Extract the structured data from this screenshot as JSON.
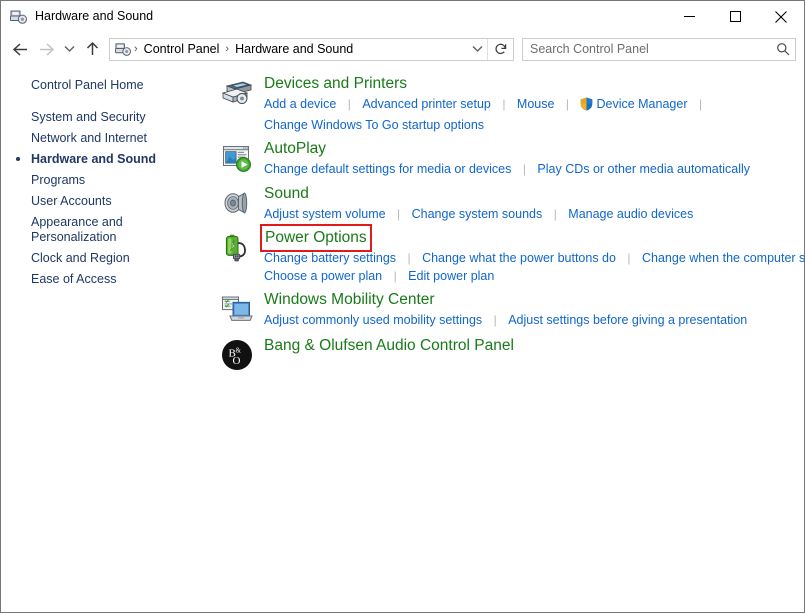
{
  "window": {
    "title": "Hardware and Sound",
    "title_icon": "devices-printers-icon",
    "minimize_label": "─",
    "maximize_label": "□",
    "close_label": "✕"
  },
  "toolbar": {
    "back_label": "Back",
    "forward_label": "Forward",
    "recent_label": "Recent locations",
    "up_label": "Up one level",
    "refresh_label": "Refresh",
    "breadcrumb": {
      "icon": "control-panel-icon",
      "items": [
        "Control Panel",
        "Hardware and Sound"
      ],
      "separator": "›"
    },
    "search": {
      "placeholder": "Search Control Panel",
      "value": "",
      "icon": "search-icon"
    }
  },
  "sidebar": {
    "home_label": "Control Panel Home",
    "items": [
      {
        "label": "System and Security",
        "current": false
      },
      {
        "label": "Network and Internet",
        "current": false
      },
      {
        "label": "Hardware and Sound",
        "current": true
      },
      {
        "label": "Programs",
        "current": false
      },
      {
        "label": "User Accounts",
        "current": false
      },
      {
        "label": "Appearance and\nPersonalization",
        "current": false
      },
      {
        "label": "Clock and Region",
        "current": false
      },
      {
        "label": "Ease of Access",
        "current": false
      }
    ]
  },
  "main": {
    "categories": [
      {
        "title": "Devices and Printers",
        "icon": "printer-icon",
        "highlighted": false,
        "link_rows": [
          [
            {
              "text": "Add a device",
              "shield": false
            },
            {
              "text": "Advanced printer setup",
              "shield": false
            },
            {
              "text": "Mouse",
              "shield": false
            },
            {
              "text": "Device Manager",
              "shield": true
            }
          ],
          [
            {
              "text": "Change Windows To Go startup options",
              "shield": false
            }
          ]
        ]
      },
      {
        "title": "AutoPlay",
        "icon": "autoplay-icon",
        "highlighted": false,
        "link_rows": [
          [
            {
              "text": "Change default settings for media or devices",
              "shield": false
            },
            {
              "text": "Play CDs or other media automatically",
              "shield": false
            }
          ]
        ]
      },
      {
        "title": "Sound",
        "icon": "speaker-icon",
        "highlighted": false,
        "link_rows": [
          [
            {
              "text": "Adjust system volume",
              "shield": false
            },
            {
              "text": "Change system sounds",
              "shield": false
            },
            {
              "text": "Manage audio devices",
              "shield": false
            }
          ]
        ]
      },
      {
        "title": "Power Options",
        "icon": "battery-icon",
        "highlighted": true,
        "link_rows": [
          [
            {
              "text": "Change battery settings",
              "shield": false
            },
            {
              "text": "Change what the power buttons do",
              "shield": false
            },
            {
              "text": "Change when the computer sleeps",
              "shield": false
            }
          ],
          [
            {
              "text": "Choose a power plan",
              "shield": false
            },
            {
              "text": "Edit power plan",
              "shield": false
            }
          ]
        ]
      },
      {
        "title": "Windows Mobility Center",
        "icon": "laptop-icon",
        "highlighted": false,
        "link_rows": [
          [
            {
              "text": "Adjust commonly used mobility settings",
              "shield": false
            },
            {
              "text": "Adjust settings before giving a presentation",
              "shield": false
            }
          ]
        ]
      },
      {
        "title": "Bang & Olufsen Audio Control Panel",
        "icon": "bang-olufsen-logo-icon",
        "highlighted": false,
        "link_rows": []
      }
    ]
  },
  "colors": {
    "heading_green": "#1a7a1a",
    "link_blue": "#1166cc",
    "sidebar_navy": "#1f3864",
    "highlight_red": "#e01b1b"
  }
}
